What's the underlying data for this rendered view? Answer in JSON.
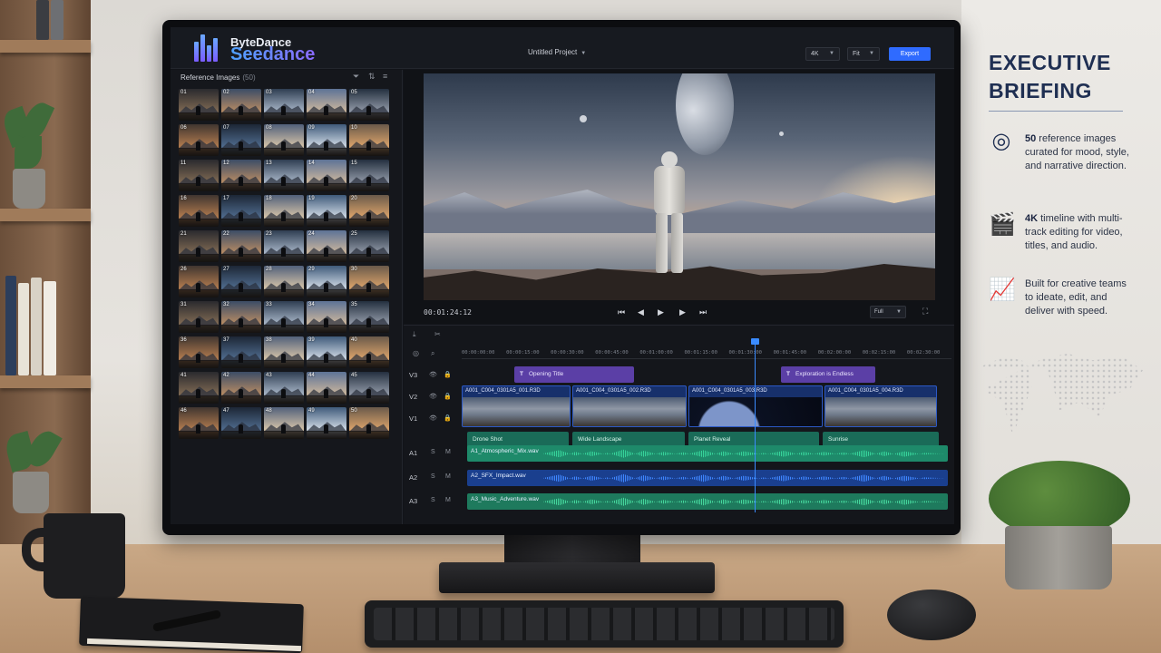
{
  "app": {
    "brand_top": "ByteDance",
    "brand_bottom": "Seedance",
    "project_title": "Untitled Project",
    "resolution": "4K",
    "zoom_mode": "Fit",
    "export_label": "Export"
  },
  "reference_panel": {
    "title": "Reference Images",
    "count": "(50)",
    "icons": [
      "filter-icon",
      "sort-icon",
      "list-view-icon"
    ],
    "thumbnails": [
      "01",
      "02",
      "03",
      "04",
      "05",
      "06",
      "07",
      "08",
      "09",
      "10",
      "11",
      "12",
      "13",
      "14",
      "15",
      "16",
      "17",
      "18",
      "19",
      "20",
      "21",
      "22",
      "23",
      "24",
      "25",
      "26",
      "27",
      "28",
      "29",
      "30",
      "31",
      "32",
      "33",
      "34",
      "35",
      "36",
      "37",
      "38",
      "39",
      "40",
      "41",
      "42",
      "43",
      "44",
      "45",
      "46",
      "47",
      "48",
      "49",
      "50"
    ]
  },
  "preview": {
    "timecode": "00:01:24:12",
    "transport_icons": [
      "skip-start-icon",
      "step-back-icon",
      "play-icon",
      "step-forward-icon",
      "skip-end-icon"
    ],
    "quality": "Full",
    "quality_options_visible": [
      "Full"
    ]
  },
  "timeline": {
    "ruler_ticks": [
      "00:00:00:00",
      "00:00:15:00",
      "00:00:30:00",
      "00:00:45:00",
      "00:01:00:00",
      "00:01:15:00",
      "00:01:30:00",
      "00:01:45:00",
      "00:02:00:00",
      "00:02:15:00",
      "00:02:30:00"
    ],
    "tracks": [
      "V3",
      "V2",
      "V1",
      "A1",
      "A2",
      "A3"
    ],
    "title_clips": [
      {
        "label": "Opening Title",
        "glyph": "T"
      },
      {
        "label": "Exploration is Endless",
        "glyph": "T"
      }
    ],
    "video_clips": [
      {
        "name": "A001_C004_0301A5_001.R3D"
      },
      {
        "name": "A001_C004_0301A5_002.R3D"
      },
      {
        "name": "A001_C004_0301A5_003.R3D"
      },
      {
        "name": "A001_C004_0301A5_004.R3D"
      }
    ],
    "shot_clips": [
      "Drone Shot",
      "Wide Landscape",
      "Planet Reveal",
      "Sunrise"
    ],
    "audio_clips": [
      {
        "name": "A1_Atmospheric_Mix.wav",
        "color": "#1e8a6a",
        "wave": "#36d39a"
      },
      {
        "name": "A2_SFX_Impact.wav",
        "color": "#1a3f8e",
        "wave": "#3f86ff"
      },
      {
        "name": "A3_Music_Adventure.wav",
        "color": "#1e7a5d",
        "wave": "#45d69c"
      }
    ],
    "solo_label": "S",
    "mute_label": "M"
  },
  "briefing": {
    "title": "EXECUTIVE BRIEFING",
    "items": [
      {
        "icon": "target-icon",
        "strong": "50",
        "text": " reference images curated for mood, style, and narrative direction."
      },
      {
        "icon": "clapperboard-icon",
        "strong": "4K",
        "text": " timeline with multi-track editing for video, titles, and audio."
      },
      {
        "icon": "growth-chart-icon",
        "strong": "",
        "text": "Built for creative teams to ideate, edit, and deliver with speed."
      }
    ]
  },
  "colors": {
    "accent": "#2f6bff",
    "title_clip": "#5b3fa6",
    "video_clip": "#17306b",
    "shot_clip": "#1a6b58",
    "briefing_text": "#1f2f52"
  }
}
